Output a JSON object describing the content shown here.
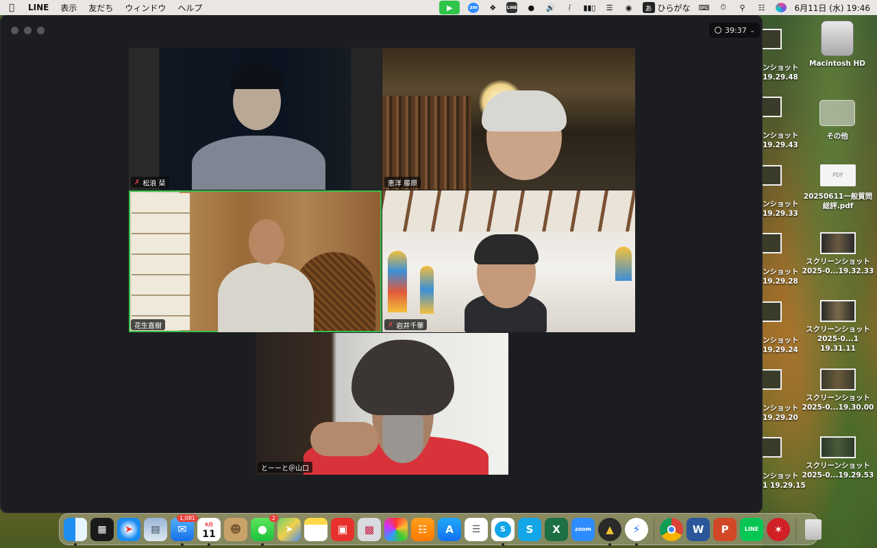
{
  "menubar": {
    "app_name": "LINE",
    "menus": [
      "表示",
      "友だち",
      "ウィンドウ",
      "ヘルプ"
    ],
    "ime_indicator": "あ",
    "ime_label": "ひらがな",
    "clock": "6月11日 (水)  19:46",
    "zoom_icon_text": "zm",
    "line_icon_text": "LINE"
  },
  "meeting": {
    "timer": "39:37",
    "participants": [
      {
        "name": "松浪 栞",
        "muted": true
      },
      {
        "name": "恵洋 藤原",
        "muted": false
      },
      {
        "name": "花生直樹",
        "muted": false,
        "active": true
      },
      {
        "name": "岩井千華",
        "muted": true
      },
      {
        "name": "とーーと＠山口",
        "muted": false
      }
    ]
  },
  "desktop": {
    "drive": {
      "label": "Macintosh HD"
    },
    "folder": {
      "label": "その他"
    },
    "pdf": {
      "line1": "20250611一般質問",
      "line2": "総評.pdf",
      "badge": "PDF"
    },
    "screenshots_right": [
      {
        "line1": "スクリーンショット",
        "line2": "2025-0...19.32.33"
      },
      {
        "line1": "スクリーンショット",
        "line2": "2025-0...1 19.31.11"
      },
      {
        "line1": "スクリーンショット",
        "line2": "2025-0...19.30.00"
      },
      {
        "line1": "スクリーンショット",
        "line2": "2025-0...19.29.53"
      }
    ],
    "screenshots_partial": [
      {
        "line1": "ンショット",
        "line2": "19.29.48"
      },
      {
        "line1": "ンショット",
        "line2": "19.29.43"
      },
      {
        "line1": "ンショット",
        "line2": "19.29.33"
      },
      {
        "line1": "ンショット",
        "line2": "19.29.28"
      },
      {
        "line1": "ンショット",
        "line2": "19.29.24"
      },
      {
        "line1": "ンショット",
        "line2": "19.29.20"
      },
      {
        "line1": "ンショット",
        "line2": "1 19.29.15"
      }
    ]
  },
  "dock": {
    "mail_badge": "1,081",
    "messages_badge": "2",
    "calendar_month": "6月",
    "calendar_day": "11",
    "zoom_label": "zoom",
    "line_label": "LINE",
    "skype_label": "S",
    "excel_label": "X",
    "word_label": "W",
    "ppt_label": "P"
  }
}
